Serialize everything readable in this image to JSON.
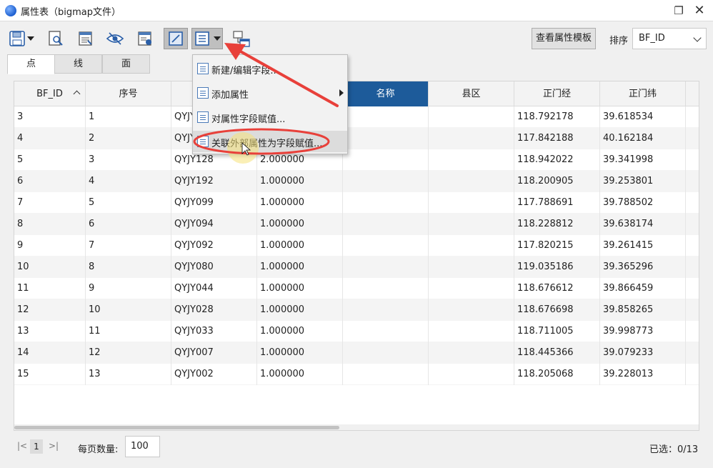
{
  "window": {
    "title": "属性表（bigmap文件）",
    "restore_symbol": "❐",
    "close_symbol": "✕"
  },
  "toolbar": {
    "icons": [
      "save-icon",
      "dropdown-arrow-icon",
      "zoom-to-feature-icon",
      "export-table-icon",
      "visibility-icon",
      "locate-icon",
      "edit-mode-icon",
      "field-menu-icon",
      "dropdown-arrow-icon",
      "link-window-icon"
    ],
    "template_button": "查看属性模板",
    "sort_label": "排序",
    "sort_value": "BF_ID"
  },
  "tabs": [
    {
      "label": "点",
      "active": true
    },
    {
      "label": "线",
      "active": false
    },
    {
      "label": "面",
      "active": false
    }
  ],
  "table": {
    "columns": [
      "BF_ID",
      "序号",
      "",
      "",
      "名称",
      "县区",
      "正门经",
      "正门纬"
    ],
    "selected_column": "名称",
    "rows": [
      [
        "3",
        "1",
        "QYJY",
        "",
        "",
        "",
        "118.792178",
        "39.618534"
      ],
      [
        "4",
        "2",
        "QYJY",
        "",
        "",
        "",
        "117.842188",
        "40.162184"
      ],
      [
        "5",
        "3",
        "QYJY128",
        "2.000000",
        "",
        "",
        "118.942022",
        "39.341998"
      ],
      [
        "6",
        "4",
        "QYJY192",
        "1.000000",
        "",
        "",
        "118.200905",
        "39.253801"
      ],
      [
        "7",
        "5",
        "QYJY099",
        "1.000000",
        "",
        "",
        "117.788691",
        "39.788502"
      ],
      [
        "8",
        "6",
        "QYJY094",
        "1.000000",
        "",
        "",
        "118.228812",
        "39.638174"
      ],
      [
        "9",
        "7",
        "QYJY092",
        "1.000000",
        "",
        "",
        "117.820215",
        "39.261415"
      ],
      [
        "10",
        "8",
        "QYJY080",
        "1.000000",
        "",
        "",
        "119.035186",
        "39.365296"
      ],
      [
        "11",
        "9",
        "QYJY044",
        "1.000000",
        "",
        "",
        "118.676612",
        "39.866459"
      ],
      [
        "12",
        "10",
        "QYJY028",
        "1.000000",
        "",
        "",
        "118.676698",
        "39.858265"
      ],
      [
        "13",
        "11",
        "QYJY033",
        "1.000000",
        "",
        "",
        "118.711005",
        "39.998773"
      ],
      [
        "14",
        "12",
        "QYJY007",
        "1.000000",
        "",
        "",
        "118.445366",
        "39.079233"
      ],
      [
        "15",
        "13",
        "QYJY002",
        "1.000000",
        "",
        "",
        "118.205068",
        "39.228013"
      ]
    ]
  },
  "pager": {
    "first_symbol": "|<",
    "current_page": "1",
    "last_symbol": ">|",
    "per_page_label": "每页数量:",
    "per_page_value": "100",
    "selected_text": "已选：0/13"
  },
  "context_menu": {
    "items": [
      {
        "label": "新建/编辑字段...",
        "has_submenu": false
      },
      {
        "label": "添加属性",
        "has_submenu": true
      },
      {
        "label": "对属性字段赋值...",
        "has_submenu": false
      },
      {
        "label": "关联外部属性为字段赋值...",
        "has_submenu": false,
        "highlighted": true
      }
    ]
  },
  "colors": {
    "selected_header": "#1d5b9a",
    "annotation_red": "#e8403a",
    "cursor_highlight": "#f5e27a"
  }
}
